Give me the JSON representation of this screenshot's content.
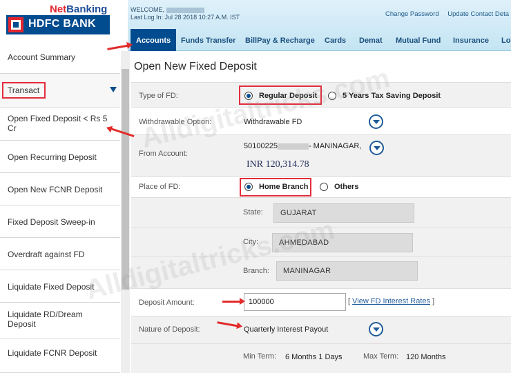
{
  "brand": {
    "netbanking_prefix": "Net",
    "netbanking_suffix": "Banking",
    "logo_text": "HDFC BANK"
  },
  "session": {
    "welcome": "WELCOME,",
    "last_login": "Last Log In: Jul 28 2018 10:27 A.M. IST"
  },
  "top_links": {
    "change_password": "Change Password",
    "update_contact": "Update Contact Deta"
  },
  "nav_tabs": [
    "Accounts",
    "Funds Transfer",
    "BillPay & Recharge",
    "Cards",
    "Demat",
    "Mutual Fund",
    "Insurance",
    "Loa"
  ],
  "sidebar": {
    "account_summary": "Account Summary",
    "section": "Transact",
    "items": [
      "Open Fixed Deposit < Rs 5 Cr",
      "Open Recurring Deposit",
      "Open New FCNR Deposit",
      "Fixed Deposit Sweep-in",
      "Overdraft against FD",
      "Liquidate Fixed Deposit",
      "Liquidate RD/Dream Deposit",
      "Liquidate FCNR Deposit"
    ]
  },
  "form": {
    "title": "Open New Fixed Deposit",
    "type_of_fd": {
      "label": "Type of FD:",
      "options": [
        "Regular Deposit",
        "5 Years Tax Saving Deposit"
      ],
      "selected": "Regular Deposit"
    },
    "withdrawable": {
      "label": "Withdrawable Option:",
      "value": "Withdrawable FD"
    },
    "from_account": {
      "label": "From Account:",
      "account_prefix": "50100225",
      "account_suffix": "- MANINAGAR,",
      "balance": "INR 120,314.78"
    },
    "place_of_fd": {
      "label": "Place of FD:",
      "options": [
        "Home Branch",
        "Others"
      ],
      "selected": "Home Branch"
    },
    "state": {
      "label": "State:",
      "value": "GUJARAT"
    },
    "city": {
      "label": "City:",
      "value": "AHMEDABAD"
    },
    "branch": {
      "label": "Branch:",
      "value": "MANINAGAR"
    },
    "deposit_amount": {
      "label": "Deposit Amount:",
      "value": "100000",
      "rates_link": "View FD Interest Rates",
      "bracket_open": "[",
      "bracket_close": "]"
    },
    "nature": {
      "label": "Nature of Deposit:",
      "value": "Quarterly Interest Payout"
    },
    "term": {
      "min_label": "Min Term:",
      "min_value": "6 Months 1 Days",
      "max_label": "Max Term:",
      "max_value": "120 Months"
    }
  },
  "watermark": "Alldigitaltricks.com",
  "colors": {
    "brand_blue": "#004c8f",
    "brand_red": "#e3262e",
    "highlight_red": "#e32c3b",
    "header_bg": "#cfe9f6"
  }
}
